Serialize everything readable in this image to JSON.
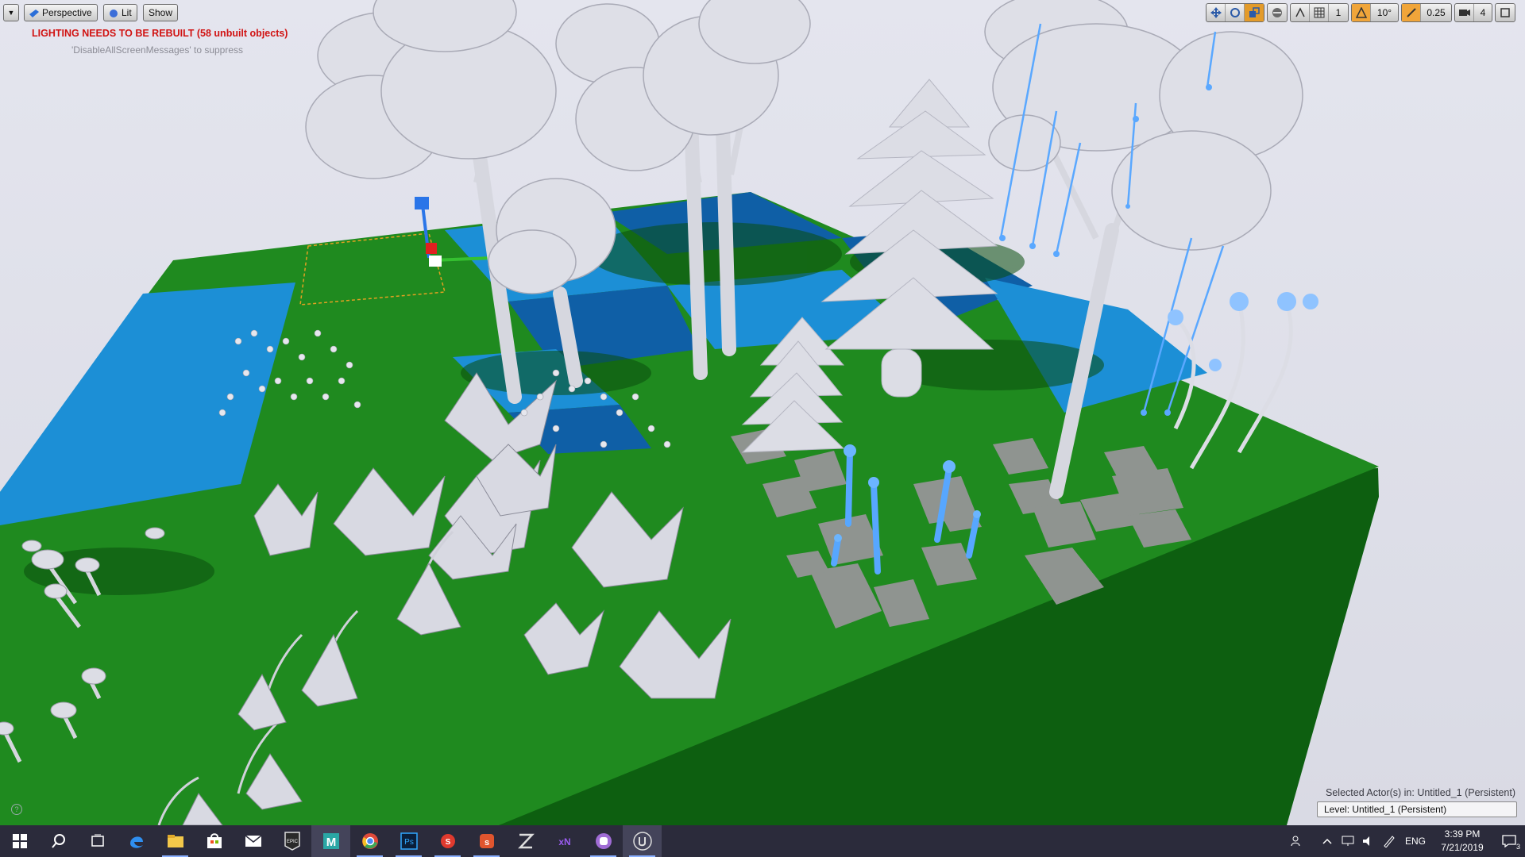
{
  "viewport": {
    "view_mode": "Perspective",
    "lighting_mode": "Lit",
    "show_label": "Show",
    "warning": "LIGHTING NEEDS TO BE REBUILT (58 unbuilt objects)",
    "suppress_hint": "'DisableAllScreenMessages' to suppress",
    "snap_rotation": "10°",
    "snap_scale": "0.25",
    "camera_speed": "4",
    "grid_value": "1",
    "selected_info": "Selected Actor(s) in:  Untitled_1 (Persistent)",
    "level_label": "Level:  Untitled_1 (Persistent)"
  },
  "taskbar": {
    "apps": [
      "start-icon",
      "search-icon",
      "task-view-icon",
      "edge-icon",
      "file-explorer-icon",
      "store-icon",
      "mail-icon",
      "epic-games-icon",
      "mudbox-icon",
      "chrome-icon",
      "photoshop-icon",
      "substance-painter-icon",
      "substance-designer-icon",
      "zbrush-icon",
      "xnormal-icon",
      "marmoset-icon",
      "unreal-engine-icon"
    ],
    "lang": "ENG",
    "time": "3:39 PM",
    "date": "7/21/2019",
    "notif_count": "3"
  },
  "colors": {
    "grass": "#1f8a1f",
    "water": "#1e8fd6",
    "water_dark": "#0f5fa6",
    "foliage": "#d8d9e2",
    "glow": "#4aa3ff",
    "warning": "#d11212"
  }
}
